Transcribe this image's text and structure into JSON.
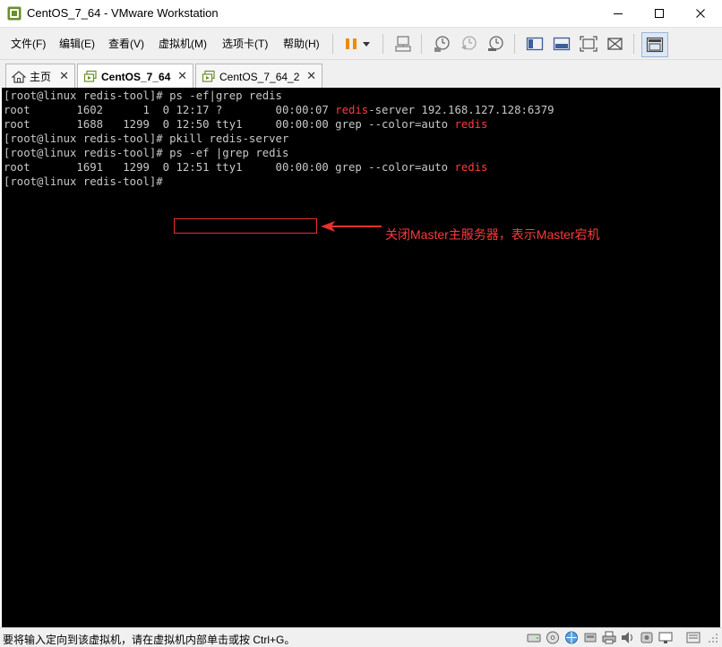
{
  "window": {
    "title": "CentOS_7_64 - VMware Workstation",
    "min_glyph": "—",
    "max_glyph": "☐",
    "close_glyph": "✕"
  },
  "menu": {
    "items": [
      "文件(F)",
      "编辑(E)",
      "查看(V)",
      "虚拟机(M)",
      "选项卡(T)",
      "帮助(H)"
    ]
  },
  "toolbar": {
    "buttons": [
      "pause-icon",
      "dropdown-arrow-icon",
      "send-ctrl-alt-del-icon",
      "snapshot-take-icon",
      "snapshot-revert-icon",
      "snapshot-manager-icon",
      "console-view-icon",
      "library-view-icon",
      "fullscreen-icon",
      "unity-icon",
      "thumbnail-view-icon"
    ]
  },
  "tabs": [
    {
      "label": "主页",
      "icon": "home-icon",
      "active": false
    },
    {
      "label": "CentOS_7_64",
      "icon": "vm-icon",
      "active": true
    },
    {
      "label": "CentOS_7_64_2",
      "icon": "vm-icon",
      "active": false
    }
  ],
  "tab_close_glyph": "✕",
  "terminal": {
    "lines": [
      {
        "segments": [
          {
            "text": "[root@linux redis-tool]# ps -ef|grep redis",
            "red": false
          }
        ]
      },
      {
        "segments": [
          {
            "text": "root       1602      1  0 12:17 ?        00:00:07 ",
            "red": false
          },
          {
            "text": "redis",
            "red": true
          },
          {
            "text": "-server 192.168.127.128:6379",
            "red": false
          }
        ]
      },
      {
        "segments": [
          {
            "text": "root       1688   1299  0 12:50 tty1     00:00:00 grep --color=auto ",
            "red": false
          },
          {
            "text": "redis",
            "red": true
          }
        ]
      },
      {
        "segments": [
          {
            "text": "[root@linux redis-tool]# pkill redis-server",
            "red": false
          }
        ]
      },
      {
        "segments": [
          {
            "text": "[root@linux redis-tool]# ps -ef |grep redis",
            "red": false
          }
        ]
      },
      {
        "segments": [
          {
            "text": "root       1691   1299  0 12:51 tty1     00:00:00 grep --color=auto ",
            "red": false
          },
          {
            "text": "redis",
            "red": true
          }
        ]
      },
      {
        "segments": [
          {
            "text": "[root@linux redis-tool]#",
            "red": false
          }
        ]
      }
    ]
  },
  "annotation": {
    "text": "关闭Master主服务器，表示Master宕机",
    "color": "#ff3a3a"
  },
  "status": {
    "text": "要将输入定向到该虚拟机，请在虚拟机内部单击或按 Ctrl+G。",
    "icons": [
      "hard-disk-icon",
      "cd-dvd-icon",
      "network-icon",
      "usb-icon",
      "printer-icon",
      "sound-icon",
      "usb-device-icon",
      "display-icon",
      "message-icon",
      "resize-grip-icon"
    ]
  },
  "colors": {
    "terminal_bg": "#000000",
    "terminal_fg": "#c8c8c8",
    "accent_red": "#ff3a3a"
  }
}
